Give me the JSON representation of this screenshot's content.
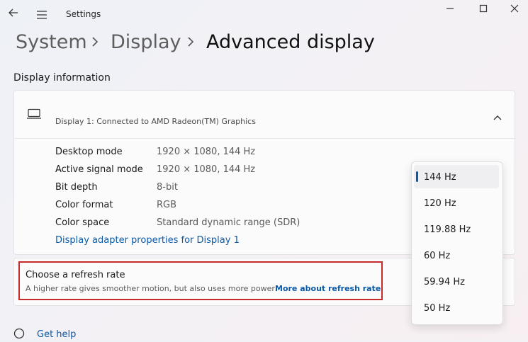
{
  "app": {
    "title": "Settings"
  },
  "breadcrumb": {
    "items": [
      "System",
      "Display"
    ],
    "current": "Advanced display"
  },
  "display_info": {
    "section_title": "Display information",
    "card_subtitle": "Display 1: Connected to AMD Radeon(TM) Graphics",
    "rows": [
      {
        "label": "Desktop mode",
        "value": "1920 × 1080, 144 Hz"
      },
      {
        "label": "Active signal mode",
        "value": "1920 × 1080, 144 Hz"
      },
      {
        "label": "Bit depth",
        "value": "8-bit"
      },
      {
        "label": "Color format",
        "value": "RGB"
      },
      {
        "label": "Color space",
        "value": "Standard dynamic range (SDR)"
      }
    ],
    "adapter_link": "Display adapter properties for Display 1"
  },
  "refresh": {
    "title": "Choose a refresh rate",
    "subtitle": "A higher rate gives smoother motion, but also uses more power",
    "link": "More about refresh rate",
    "options": [
      "144 Hz",
      "120 Hz",
      "119.88 Hz",
      "60 Hz",
      "59.94 Hz",
      "50 Hz"
    ],
    "selected": "144 Hz"
  },
  "help": {
    "label": "Get help"
  },
  "icons": {
    "back": "back-arrow-icon",
    "menu": "hamburger-menu-icon",
    "minimize": "minimize-icon",
    "maximize": "maximize-icon",
    "close": "close-icon",
    "laptop": "laptop-icon",
    "collapse": "chevron-up-icon",
    "help": "help-icon"
  },
  "colors": {
    "accent": "#0a5aa8",
    "highlight": "#c42b2b"
  }
}
